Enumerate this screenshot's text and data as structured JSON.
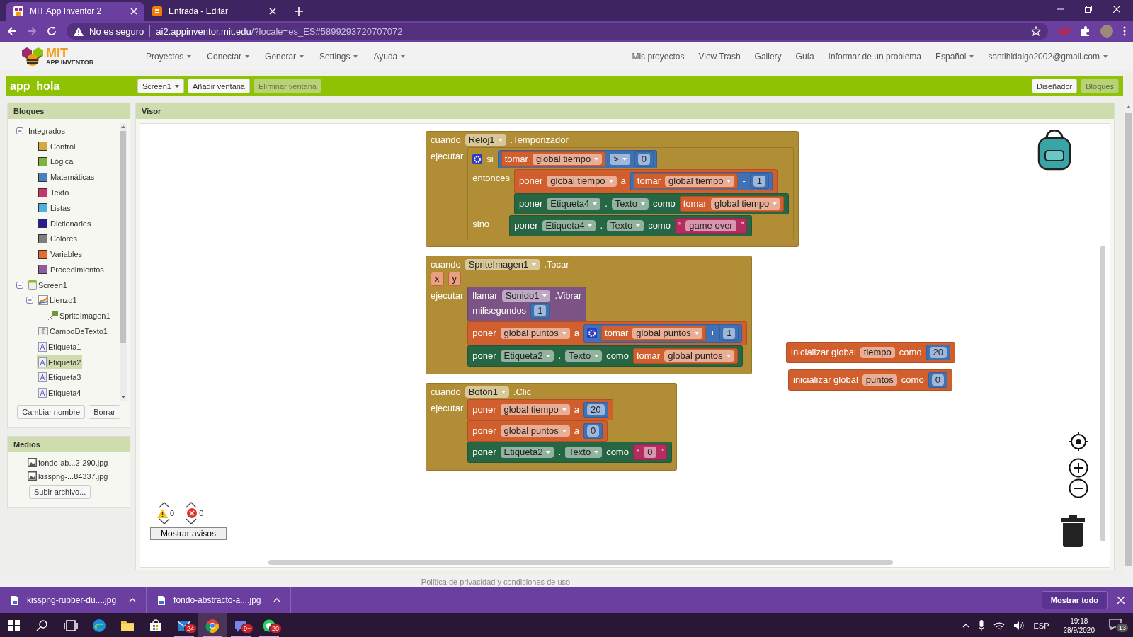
{
  "browser": {
    "tabs": [
      {
        "title": "MIT App Inventor 2",
        "selected": true
      },
      {
        "title": "Entrada - Editar",
        "selected": false
      }
    ],
    "address": {
      "security": "No es seguro",
      "host": "ai2.appinventor.mit.edu",
      "path": "/?locale=es_ES#5899293720707072"
    },
    "extension_label": "NP"
  },
  "app_header": {
    "logo": {
      "line1": "MIT",
      "line2": "APP INVENTOR"
    },
    "menus": [
      "Proyectos",
      "Conectar",
      "Generar",
      "Settings",
      "Ayuda"
    ],
    "links": [
      {
        "label": "Mis proyectos",
        "dropdown": false
      },
      {
        "label": "View Trash",
        "dropdown": false
      },
      {
        "label": "Gallery",
        "dropdown": false
      },
      {
        "label": "Guía",
        "dropdown": false
      },
      {
        "label": "Informar de un problema",
        "dropdown": false
      },
      {
        "label": "Español",
        "dropdown": true
      },
      {
        "label": "santihidalgo2002@gmail.com",
        "dropdown": true
      }
    ]
  },
  "project_bar": {
    "title": "app_hola",
    "buttons": [
      {
        "label": "Screen1",
        "dropdown": true,
        "disabled": false
      },
      {
        "label": "Añadir ventana",
        "dropdown": false,
        "disabled": false
      },
      {
        "label": "Eliminar ventana",
        "dropdown": false,
        "disabled": true
      }
    ],
    "view_buttons": [
      {
        "label": "Diseñador",
        "selected": false
      },
      {
        "label": "Bloques",
        "selected": true
      }
    ]
  },
  "blocks_panel": {
    "title": "Bloques",
    "tree": [
      {
        "label": "Integrados",
        "kind": "group",
        "selected": false,
        "expanded": true,
        "children": [
          {
            "label": "Control",
            "kind": "category",
            "color": "#d4a93f",
            "selected": false
          },
          {
            "label": "Lógica",
            "kind": "category",
            "color": "#7fb241",
            "selected": false
          },
          {
            "label": "Matemáticas",
            "kind": "category",
            "color": "#4a7fc1",
            "selected": false
          },
          {
            "label": "Texto",
            "kind": "category",
            "color": "#c8376a",
            "selected": false
          },
          {
            "label": "Listas",
            "kind": "category",
            "color": "#4eb0dd",
            "selected": false
          },
          {
            "label": "Dictionaries",
            "kind": "category",
            "color": "#2a1a9a",
            "selected": false
          },
          {
            "label": "Colores",
            "kind": "category",
            "color": "#7f7f7f",
            "selected": false
          },
          {
            "label": "Variables",
            "kind": "category",
            "color": "#e66b2c",
            "selected": false
          },
          {
            "label": "Procedimientos",
            "kind": "category",
            "color": "#8e5d9d",
            "selected": false
          }
        ]
      },
      {
        "label": "Screen1",
        "kind": "screen",
        "selected": false,
        "expanded": true,
        "children": [
          {
            "label": "Lienzo1",
            "kind": "canvas",
            "selected": false,
            "expanded": true,
            "children": [
              {
                "label": "SpriteImagen1",
                "kind": "sprite",
                "selected": false
              }
            ]
          },
          {
            "label": "CampoDeTexto1",
            "kind": "textbox",
            "selected": false
          },
          {
            "label": "Etiqueta1",
            "kind": "label",
            "selected": false
          },
          {
            "label": "Etiqueta2",
            "kind": "label",
            "selected": true
          },
          {
            "label": "Etiqueta3",
            "kind": "label",
            "selected": false
          },
          {
            "label": "Etiqueta4",
            "kind": "label",
            "selected": false
          }
        ]
      }
    ],
    "buttons": [
      "Cambiar nombre",
      "Borrar"
    ]
  },
  "media_panel": {
    "title": "Medios",
    "files": [
      "fondo-ab...2-290.jpg",
      "kisspng-...84337.jpg"
    ],
    "upload_button": "Subir archivo..."
  },
  "viewer": {
    "title": "Visor",
    "blocks": [
      {
        "kind": "event",
        "lines": [
          [
            {
              "kind": "word",
              "text": "cuando"
            },
            {
              "kind": "field",
              "text": "Reloj1",
              "dropdown": true
            },
            {
              "kind": "word",
              "text": ".Temporizador"
            }
          ],
          [
            {
              "kind": "word",
              "text": "ejecutar"
            },
            {
              "kind": "stack",
              "blocks": [
                {
                  "kind": "control",
                  "lines": [
                    [
                      {
                        "kind": "mutator"
                      },
                      {
                        "kind": "word",
                        "text": "si"
                      },
                      {
                        "kind": "block",
                        "block": {
                          "kind": "math",
                          "lines": [
                            [
                              {
                                "kind": "block",
                                "block": {
                                  "kind": "variable",
                                  "lines": [
                                    [
                                      {
                                        "kind": "word",
                                        "text": "tomar"
                                      },
                                      {
                                        "kind": "field",
                                        "text": "global tiempo",
                                        "dropdown": true
                                      }
                                    ]
                                  ]
                                }
                              },
                              {
                                "kind": "field",
                                "text": ">",
                                "dropdown": true
                              },
                              {
                                "kind": "block",
                                "block": {
                                  "kind": "math",
                                  "lines": [
                                    [
                                      {
                                        "kind": "field",
                                        "text": "0",
                                        "dropdown": false
                                      }
                                    ]
                                  ]
                                }
                              }
                            ]
                          ]
                        }
                      }
                    ],
                    [
                      {
                        "kind": "word",
                        "text": "entonces"
                      },
                      {
                        "kind": "stack",
                        "blocks": [
                          {
                            "kind": "variable",
                            "lines": [
                              [
                                {
                                  "kind": "word",
                                  "text": "poner"
                                },
                                {
                                  "kind": "field",
                                  "text": "global tiempo",
                                  "dropdown": true
                                },
                                {
                                  "kind": "word",
                                  "text": "a"
                                },
                                {
                                  "kind": "block",
                                  "block": {
                                    "kind": "math",
                                    "lines": [
                                      [
                                        {
                                          "kind": "block",
                                          "block": {
                                            "kind": "variable",
                                            "lines": [
                                              [
                                                {
                                                  "kind": "word",
                                                  "text": "tomar"
                                                },
                                                {
                                                  "kind": "field",
                                                  "text": "global tiempo",
                                                  "dropdown": true
                                                }
                                              ]
                                            ]
                                          }
                                        },
                                        {
                                          "kind": "word",
                                          "text": "-"
                                        },
                                        {
                                          "kind": "block",
                                          "block": {
                                            "kind": "math",
                                            "lines": [
                                              [
                                                {
                                                  "kind": "field",
                                                  "text": "1",
                                                  "dropdown": false
                                                }
                                              ]
                                            ]
                                          }
                                        }
                                      ]
                                    ]
                                  }
                                }
                              ]
                            ]
                          },
                          {
                            "kind": "setter",
                            "lines": [
                              [
                                {
                                  "kind": "word",
                                  "text": "poner"
                                },
                                {
                                  "kind": "field",
                                  "text": "Etiqueta4",
                                  "dropdown": true
                                },
                                {
                                  "kind": "word",
                                  "text": "."
                                },
                                {
                                  "kind": "field",
                                  "text": "Texto",
                                  "dropdown": true
                                },
                                {
                                  "kind": "word",
                                  "text": "como"
                                },
                                {
                                  "kind": "block",
                                  "block": {
                                    "kind": "variable",
                                    "lines": [
                                      [
                                        {
                                          "kind": "word",
                                          "text": "tomar"
                                        },
                                        {
                                          "kind": "field",
                                          "text": "global tiempo",
                                          "dropdown": true
                                        }
                                      ]
                                    ]
                                  }
                                }
                              ]
                            ]
                          }
                        ]
                      }
                    ],
                    [
                      {
                        "kind": "word",
                        "text": "sino"
                      },
                      {
                        "kind": "stack",
                        "blocks": [
                          {
                            "kind": "setter",
                            "lines": [
                              [
                                {
                                  "kind": "word",
                                  "text": "poner"
                                },
                                {
                                  "kind": "field",
                                  "text": "Etiqueta4",
                                  "dropdown": true
                                },
                                {
                                  "kind": "word",
                                  "text": "."
                                },
                                {
                                  "kind": "field",
                                  "text": "Texto",
                                  "dropdown": true
                                },
                                {
                                  "kind": "word",
                                  "text": "como"
                                },
                                {
                                  "kind": "block",
                                  "block": {
                                    "kind": "text",
                                    "lines": [
                                      [
                                        {
                                          "kind": "word",
                                          "text": "“"
                                        },
                                        {
                                          "kind": "field",
                                          "text": "game over",
                                          "dropdown": false
                                        },
                                        {
                                          "kind": "word",
                                          "text": "”"
                                        }
                                      ]
                                    ]
                                  }
                                }
                              ]
                            ]
                          }
                        ]
                      }
                    ]
                  ]
                }
              ]
            }
          ]
        ]
      },
      {
        "kind": "event",
        "lines": [
          [
            {
              "kind": "word",
              "text": "cuando"
            },
            {
              "kind": "field",
              "text": "SpriteImagen1",
              "dropdown": true
            },
            {
              "kind": "word",
              "text": ".Tocar"
            }
          ],
          [
            {
              "kind": "param",
              "text": "x"
            },
            {
              "kind": "param",
              "text": "y"
            }
          ],
          [
            {
              "kind": "word",
              "text": "ejecutar"
            },
            {
              "kind": "stack",
              "blocks": [
                {
                  "kind": "method",
                  "lines": [
                    [
                      {
                        "kind": "word",
                        "text": "llamar"
                      },
                      {
                        "kind": "field",
                        "text": "Sonido1",
                        "dropdown": true
                      },
                      {
                        "kind": "word",
                        "text": ".Vibrar"
                      }
                    ],
                    [
                      {
                        "kind": "word",
                        "text": "milisegundos"
                      },
                      {
                        "kind": "block",
                        "block": {
                          "kind": "math",
                          "lines": [
                            [
                              {
                                "kind": "field",
                                "text": "1",
                                "dropdown": false
                              }
                            ]
                          ]
                        }
                      }
                    ]
                  ]
                },
                {
                  "kind": "variable",
                  "lines": [
                    [
                      {
                        "kind": "word",
                        "text": "poner"
                      },
                      {
                        "kind": "field",
                        "text": "global puntos",
                        "dropdown": true
                      },
                      {
                        "kind": "word",
                        "text": "a"
                      },
                      {
                        "kind": "block",
                        "block": {
                          "kind": "math",
                          "lines": [
                            [
                              {
                                "kind": "mutator"
                              },
                              {
                                "kind": "block",
                                "block": {
                                  "kind": "variable",
                                  "lines": [
                                    [
                                      {
                                        "kind": "word",
                                        "text": "tomar"
                                      },
                                      {
                                        "kind": "field",
                                        "text": "global puntos",
                                        "dropdown": true
                                      }
                                    ]
                                  ]
                                }
                              },
                              {
                                "kind": "word",
                                "text": "+"
                              },
                              {
                                "kind": "block",
                                "block": {
                                  "kind": "math",
                                  "lines": [
                                    [
                                      {
                                        "kind": "field",
                                        "text": "1",
                                        "dropdown": false
                                      }
                                    ]
                                  ]
                                }
                              }
                            ]
                          ]
                        }
                      }
                    ]
                  ]
                },
                {
                  "kind": "setter",
                  "lines": [
                    [
                      {
                        "kind": "word",
                        "text": "poner"
                      },
                      {
                        "kind": "field",
                        "text": "Etiqueta2",
                        "dropdown": true
                      },
                      {
                        "kind": "word",
                        "text": "."
                      },
                      {
                        "kind": "field",
                        "text": "Texto",
                        "dropdown": true
                      },
                      {
                        "kind": "word",
                        "text": "como"
                      },
                      {
                        "kind": "block",
                        "block": {
                          "kind": "variable",
                          "lines": [
                            [
                              {
                                "kind": "word",
                                "text": "tomar"
                              },
                              {
                                "kind": "field",
                                "text": "global puntos",
                                "dropdown": true
                              }
                            ]
                          ]
                        }
                      }
                    ]
                  ]
                }
              ]
            }
          ]
        ]
      },
      {
        "kind": "event",
        "lines": [
          [
            {
              "kind": "word",
              "text": "cuando"
            },
            {
              "kind": "field",
              "text": "Botón1",
              "dropdown": true
            },
            {
              "kind": "word",
              "text": ".Clic"
            }
          ],
          [
            {
              "kind": "word",
              "text": "ejecutar"
            },
            {
              "kind": "stack",
              "blocks": [
                {
                  "kind": "variable",
                  "lines": [
                    [
                      {
                        "kind": "word",
                        "text": "poner"
                      },
                      {
                        "kind": "field",
                        "text": "global tiempo",
                        "dropdown": true
                      },
                      {
                        "kind": "word",
                        "text": "a"
                      },
                      {
                        "kind": "block",
                        "block": {
                          "kind": "math",
                          "lines": [
                            [
                              {
                                "kind": "field",
                                "text": "20",
                                "dropdown": false
                              }
                            ]
                          ]
                        }
                      }
                    ]
                  ]
                },
                {
                  "kind": "variable",
                  "lines": [
                    [
                      {
                        "kind": "word",
                        "text": "poner"
                      },
                      {
                        "kind": "field",
                        "text": "global puntos",
                        "dropdown": true
                      },
                      {
                        "kind": "word",
                        "text": "a"
                      },
                      {
                        "kind": "block",
                        "block": {
                          "kind": "math",
                          "lines": [
                            [
                              {
                                "kind": "field",
                                "text": "0",
                                "dropdown": false
                              }
                            ]
                          ]
                        }
                      }
                    ]
                  ]
                },
                {
                  "kind": "setter",
                  "lines": [
                    [
                      {
                        "kind": "word",
                        "text": "poner"
                      },
                      {
                        "kind": "field",
                        "text": "Etiqueta2",
                        "dropdown": true
                      },
                      {
                        "kind": "word",
                        "text": "."
                      },
                      {
                        "kind": "field",
                        "text": "Texto",
                        "dropdown": true
                      },
                      {
                        "kind": "word",
                        "text": "como"
                      },
                      {
                        "kind": "block",
                        "block": {
                          "kind": "text",
                          "lines": [
                            [
                              {
                                "kind": "word",
                                "text": "“"
                              },
                              {
                                "kind": "field",
                                "text": "0",
                                "dropdown": false
                              },
                              {
                                "kind": "word",
                                "text": "”"
                              }
                            ]
                          ]
                        }
                      }
                    ]
                  ]
                }
              ]
            }
          ]
        ]
      },
      {
        "kind": "variable",
        "lines": [
          [
            {
              "kind": "word",
              "text": "inicializar global"
            },
            {
              "kind": "field",
              "text": "tiempo",
              "dropdown": false
            },
            {
              "kind": "word",
              "text": "como"
            },
            {
              "kind": "block",
              "block": {
                "kind": "math",
                "lines": [
                  [
                    {
                      "kind": "field",
                      "text": "20",
                      "dropdown": false
                    }
                  ]
                ]
              }
            }
          ]
        ]
      },
      {
        "kind": "variable",
        "lines": [
          [
            {
              "kind": "word",
              "text": "inicializar global"
            },
            {
              "kind": "field",
              "text": "puntos",
              "dropdown": false
            },
            {
              "kind": "word",
              "text": "como"
            },
            {
              "kind": "block",
              "block": {
                "kind": "math",
                "lines": [
                  [
                    {
                      "kind": "field",
                      "text": "0",
                      "dropdown": false
                    }
                  ]
                ]
              }
            }
          ]
        ]
      }
    ],
    "warnings": {
      "warning_count": "0",
      "error_count": "0",
      "button": "Mostrar avisos"
    }
  },
  "footer": "Política de privacidad y condiciones de uso",
  "downloads": {
    "items": [
      "kisspng-rubber-du....jpg",
      "fondo-abstracto-a....jpg"
    ],
    "show_all": "Mostrar todo"
  },
  "taskbar": {
    "apps": [
      {
        "kind": "start",
        "selected": false,
        "running": false
      },
      {
        "kind": "search",
        "selected": false,
        "running": false
      },
      {
        "kind": "taskview",
        "selected": false,
        "running": false
      },
      {
        "kind": "edge",
        "selected": false,
        "running": false
      },
      {
        "kind": "files",
        "selected": false,
        "running": false
      },
      {
        "kind": "store",
        "selected": false,
        "running": false
      },
      {
        "kind": "mail",
        "badge": "24",
        "selected": false,
        "running": true
      },
      {
        "kind": "chrome",
        "selected": true,
        "running": true
      },
      {
        "kind": "teams",
        "badge": "9+",
        "selected": false,
        "running": true
      },
      {
        "kind": "whatsapp",
        "badge": "20",
        "selected": false,
        "running": true
      }
    ],
    "language": "ESP",
    "time": "19:18",
    "date": "28/9/2020",
    "notifications": "13"
  }
}
